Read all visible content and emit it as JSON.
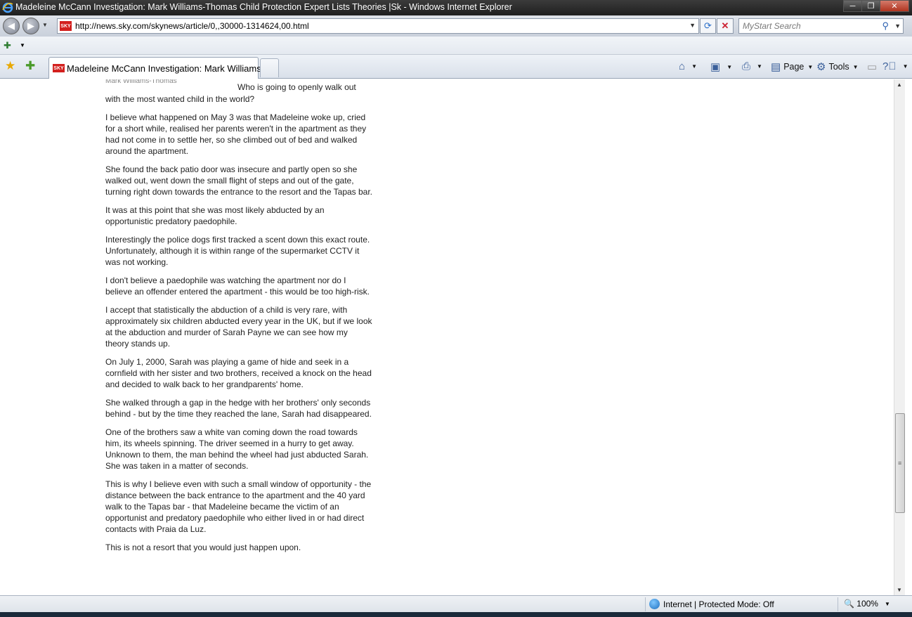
{
  "window": {
    "title": "Madeleine McCann Investigation: Mark Williams-Thomas Child Protection Expert Lists Theories |Sk - Windows Internet Explorer",
    "minimize": "─",
    "maximize": "❐",
    "close": "✕"
  },
  "navbar": {
    "url": "http://news.sky.com/skynews/article/0,,30000-1314624,00.html",
    "search_placeholder": "MyStart Search",
    "sky_badge": "SKY"
  },
  "tabs": [
    {
      "label": "Madeleine McCann Investigation: Mark Williams-...",
      "badge": "SKY"
    }
  ],
  "commandbar": {
    "page_label": "Page",
    "tools_label": "Tools"
  },
  "article": {
    "photo_caption": "Mark Williams-Thomas",
    "pull_quote": "Who is going to openly walk out",
    "paragraphs": [
      "with the most wanted child in the world?",
      "I believe what happened on May 3 was that Madeleine woke up, cried for a short while, realised her parents weren't in the apartment as they had not come in to settle her, so she climbed out of bed and walked around the apartment.",
      "She found the back patio door was insecure and partly open so she walked out, went down the small flight of steps and out of the gate, turning right down towards the entrance to the resort and the Tapas bar.",
      "It was at this point that she was most likely abducted by an opportunistic predatory paedophile.",
      "Interestingly the police dogs first tracked a scent down this exact route. Unfortunately, although it is within range of the supermarket CCTV it was not working.",
      "I don't believe a paedophile was watching the apartment nor do I believe an offender entered the apartment - this would be too high-risk.",
      "I accept that statistically the abduction of a child is very rare, with approximately six children abducted every year in the UK, but if we look at the abduction and murder of Sarah Payne we can see how my theory stands up.",
      "On July 1, 2000, Sarah was playing a game of hide and seek in a cornfield with her sister and two brothers, received a knock on the head and decided to walk back to her grandparents' home.",
      "She walked through a gap in the hedge with her brothers' only seconds behind - but by the time they reached the lane, Sarah had disappeared.",
      "One of the brothers saw a white van coming down the road towards him, its wheels spinning. The driver seemed in a hurry to get away. Unknown to them, the man behind the wheel had just abducted Sarah. She was taken in a matter of seconds.",
      "This is why I believe even with such a small window of opportunity - the distance between the back entrance to the apartment and the 40 yard walk to the Tapas bar - that Madeleine became the victim of an opportunist and predatory paedophile who either lived in or had direct contacts with Praia da Luz.",
      "This is not a resort that you would just happen upon."
    ]
  },
  "statusbar": {
    "zone": "Internet | Protected Mode: Off",
    "zoom": "100%"
  },
  "colors": {
    "titlebar": "#2b2b2b",
    "sky_red": "#d3201e",
    "link_blue": "#2a5fb0"
  }
}
